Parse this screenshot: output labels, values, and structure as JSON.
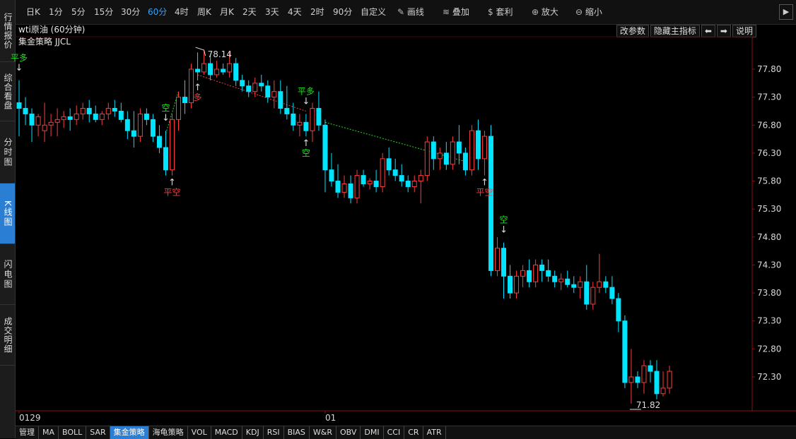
{
  "sidebar": {
    "tabs": [
      {
        "label": "行情报价",
        "active": false
      },
      {
        "label": "综合看盘",
        "active": false
      },
      {
        "label": "分时图",
        "active": false
      },
      {
        "label": "K线图",
        "active": true
      },
      {
        "label": "闪电图",
        "active": false
      },
      {
        "label": "成交明细",
        "active": false
      }
    ]
  },
  "toolbar": {
    "periods": [
      "日K",
      "1分",
      "5分",
      "15分",
      "30分",
      "60分",
      "4时",
      "周K",
      "月K",
      "2天",
      "3天",
      "4天",
      "2时",
      "90分",
      "自定义"
    ],
    "active_period": "60分",
    "tools": [
      {
        "label": "画线",
        "icon": "pencil-icon"
      },
      {
        "label": "叠加",
        "icon": "stack-icon"
      },
      {
        "label": "套利",
        "icon": "money-bag-icon"
      },
      {
        "label": "放大",
        "icon": "zoom-in-icon"
      },
      {
        "label": "缩小",
        "icon": "zoom-out-icon"
      }
    ],
    "expand_icon": "chevron-right-icon"
  },
  "chart_header": {
    "title": "wti原油 (60分钟)",
    "strategy": "集金策略 JJCL",
    "buttons": [
      "改参数",
      "隐藏主指标",
      "⬅",
      "➡",
      "说明"
    ]
  },
  "chart_data": {
    "type": "candlestick",
    "y_ticks": [
      77.8,
      77.3,
      76.8,
      76.3,
      75.8,
      75.3,
      74.8,
      74.3,
      73.8,
      73.3,
      72.8,
      72.3
    ],
    "ylim": [
      71.74,
      78.42
    ],
    "x_tick_labels": [
      {
        "label": "0129",
        "index": 0
      },
      {
        "label": "01",
        "index": 48
      }
    ],
    "colors": {
      "up": "#ff3c3c",
      "down": "#00e5ff",
      "axis": "#8a1010",
      "signal_buy": "#ff3c3c",
      "signal_sell": "#22dd22"
    },
    "high_label": "78.14",
    "low_label": "71.82",
    "candles": [
      [
        77.2,
        77.6,
        76.6,
        77.1
      ],
      [
        77.1,
        77.3,
        76.8,
        77.0
      ],
      [
        77.0,
        77.1,
        76.5,
        76.8
      ],
      [
        76.8,
        77.0,
        76.6,
        76.95
      ],
      [
        76.7,
        77.2,
        76.5,
        76.8
      ],
      [
        76.8,
        77.0,
        76.6,
        76.85
      ],
      [
        76.85,
        77.1,
        76.6,
        76.9
      ],
      [
        76.9,
        77.05,
        76.75,
        76.95
      ],
      [
        76.95,
        77.1,
        76.7,
        76.9
      ],
      [
        76.9,
        77.15,
        76.8,
        77.0
      ],
      [
        77.0,
        77.2,
        76.9,
        77.1
      ],
      [
        77.1,
        77.25,
        76.85,
        77.0
      ],
      [
        77.0,
        77.15,
        76.85,
        76.9
      ],
      [
        76.9,
        77.05,
        76.8,
        77.0
      ],
      [
        77.0,
        77.2,
        76.9,
        77.1
      ],
      [
        77.1,
        77.25,
        76.95,
        77.05
      ],
      [
        77.05,
        77.2,
        76.85,
        76.9
      ],
      [
        76.9,
        77.05,
        76.55,
        76.7
      ],
      [
        76.7,
        77.05,
        76.4,
        76.6
      ],
      [
        76.6,
        77.1,
        76.5,
        77.0
      ],
      [
        77.0,
        77.1,
        76.8,
        76.9
      ],
      [
        76.9,
        77.0,
        76.5,
        76.6
      ],
      [
        76.6,
        76.8,
        76.3,
        76.4
      ],
      [
        76.4,
        76.7,
        75.9,
        76.0
      ],
      [
        76.0,
        77.0,
        75.9,
        76.9
      ],
      [
        76.9,
        77.4,
        76.7,
        77.3
      ],
      [
        77.3,
        77.6,
        77.0,
        77.2
      ],
      [
        77.2,
        77.9,
        77.1,
        77.8
      ],
      [
        77.8,
        78.1,
        77.6,
        77.75
      ],
      [
        77.75,
        78.14,
        77.7,
        77.9
      ],
      [
        77.9,
        78.05,
        77.6,
        77.7
      ],
      [
        77.7,
        77.95,
        77.65,
        77.8
      ],
      [
        77.8,
        77.9,
        77.7,
        77.75
      ],
      [
        77.75,
        78.1,
        77.65,
        77.9
      ],
      [
        77.9,
        78.0,
        77.5,
        77.6
      ],
      [
        77.6,
        77.7,
        77.4,
        77.5
      ],
      [
        77.5,
        77.6,
        77.3,
        77.4
      ],
      [
        77.4,
        77.65,
        77.3,
        77.55
      ],
      [
        77.55,
        77.7,
        77.4,
        77.5
      ],
      [
        77.5,
        77.6,
        77.2,
        77.3
      ],
      [
        77.3,
        77.6,
        77.1,
        77.4
      ],
      [
        77.4,
        77.6,
        77.0,
        77.1
      ],
      [
        77.1,
        77.5,
        76.9,
        77.0
      ],
      [
        77.0,
        77.2,
        76.7,
        76.8
      ],
      [
        76.8,
        77.0,
        76.6,
        76.85
      ],
      [
        76.85,
        77.0,
        76.6,
        76.7
      ],
      [
        76.7,
        77.2,
        76.5,
        77.1
      ],
      [
        77.1,
        77.4,
        76.7,
        76.8
      ],
      [
        76.8,
        76.9,
        75.6,
        76.0
      ],
      [
        76.0,
        76.3,
        75.7,
        75.8
      ],
      [
        75.8,
        76.1,
        75.5,
        75.6
      ],
      [
        75.6,
        75.9,
        75.5,
        75.75
      ],
      [
        75.75,
        75.9,
        75.4,
        75.5
      ],
      [
        75.5,
        76.0,
        75.4,
        75.9
      ],
      [
        75.9,
        76.0,
        75.7,
        75.75
      ],
      [
        75.75,
        75.85,
        75.65,
        75.8
      ],
      [
        75.8,
        76.0,
        75.6,
        75.7
      ],
      [
        75.7,
        76.3,
        75.6,
        76.2
      ],
      [
        76.2,
        76.4,
        75.9,
        76.0
      ],
      [
        76.0,
        76.2,
        75.8,
        75.9
      ],
      [
        75.9,
        76.1,
        75.7,
        75.8
      ],
      [
        75.8,
        75.9,
        75.6,
        75.7
      ],
      [
        75.7,
        75.9,
        75.6,
        75.8
      ],
      [
        75.8,
        76.0,
        75.4,
        75.9
      ],
      [
        75.9,
        76.6,
        75.8,
        76.5
      ],
      [
        76.5,
        76.6,
        76.0,
        76.2
      ],
      [
        76.2,
        76.4,
        76.0,
        76.3
      ],
      [
        76.3,
        76.5,
        76.0,
        76.1
      ],
      [
        76.1,
        76.6,
        76.0,
        76.5
      ],
      [
        76.5,
        76.8,
        76.1,
        76.3
      ],
      [
        76.3,
        76.4,
        75.9,
        76.0
      ],
      [
        76.0,
        76.8,
        75.9,
        76.7
      ],
      [
        76.7,
        76.9,
        76.0,
        76.2
      ],
      [
        76.2,
        76.7,
        75.9,
        76.6
      ],
      [
        76.6,
        76.8,
        74.1,
        74.2
      ],
      [
        74.2,
        74.8,
        74.1,
        74.6
      ],
      [
        74.6,
        74.7,
        73.7,
        74.1
      ],
      [
        74.1,
        74.3,
        73.7,
        73.8
      ],
      [
        73.8,
        74.2,
        73.7,
        74.1
      ],
      [
        74.1,
        74.3,
        73.9,
        74.2
      ],
      [
        74.2,
        74.4,
        73.9,
        74.0
      ],
      [
        74.0,
        74.4,
        73.9,
        74.3
      ],
      [
        74.3,
        74.4,
        74.0,
        74.2
      ],
      [
        74.2,
        74.4,
        74.0,
        74.1
      ],
      [
        74.1,
        74.2,
        73.9,
        74.0
      ],
      [
        74.0,
        74.15,
        73.85,
        74.05
      ],
      [
        74.05,
        74.2,
        73.9,
        73.95
      ],
      [
        73.95,
        74.1,
        73.8,
        73.9
      ],
      [
        73.9,
        74.1,
        73.7,
        74.0
      ],
      [
        74.0,
        74.3,
        73.5,
        73.6
      ],
      [
        73.6,
        74.0,
        73.5,
        73.9
      ],
      [
        73.9,
        74.5,
        73.8,
        74.0
      ],
      [
        74.0,
        74.1,
        73.8,
        73.9
      ],
      [
        73.9,
        74.1,
        73.6,
        73.7
      ],
      [
        73.7,
        73.8,
        73.1,
        73.3
      ],
      [
        73.3,
        73.4,
        72.1,
        72.2
      ],
      [
        72.2,
        72.8,
        71.82,
        72.3
      ],
      [
        72.3,
        72.4,
        72.1,
        72.2
      ],
      [
        72.2,
        72.6,
        72.0,
        72.5
      ],
      [
        72.5,
        72.6,
        72.2,
        72.4
      ],
      [
        72.4,
        72.6,
        71.9,
        72.0
      ],
      [
        72.0,
        72.4,
        71.95,
        72.1
      ],
      [
        72.1,
        72.5,
        72.0,
        72.4
      ]
    ],
    "signals": [
      {
        "index": 0,
        "label": "平多",
        "kind": "sell",
        "pos": "above"
      },
      {
        "index": 23,
        "label": "空",
        "kind": "sell",
        "pos": "above"
      },
      {
        "index": 24,
        "label": "平空",
        "kind": "buy",
        "pos": "below"
      },
      {
        "index": 28,
        "label": "多",
        "kind": "buy",
        "pos": "below"
      },
      {
        "index": 45,
        "label": "平多",
        "kind": "sell",
        "pos": "above"
      },
      {
        "index": 45,
        "label": "空",
        "kind": "sell",
        "pos": "below"
      },
      {
        "index": 73,
        "label": "平空",
        "kind": "buy",
        "pos": "below"
      },
      {
        "index": 76,
        "label": "空",
        "kind": "sell",
        "pos": "above"
      }
    ],
    "trend_lines": [
      {
        "from": [
          23,
          76.65
        ],
        "to": [
          25,
          77.4
        ],
        "color": "#22dd22"
      },
      {
        "from": [
          28,
          77.7
        ],
        "to": [
          45,
          77.05
        ],
        "color": "#ff3c3c"
      },
      {
        "from": [
          48,
          76.85
        ],
        "to": [
          70,
          76.15
        ],
        "color": "#22dd22"
      }
    ]
  },
  "bottom_tabs": {
    "items": [
      "管理",
      "MA",
      "BOLL",
      "SAR",
      "集金策略",
      "海龟策略",
      "VOL",
      "MACD",
      "KDJ",
      "RSI",
      "BIAS",
      "W&R",
      "OBV",
      "DMI",
      "CCI",
      "CR",
      "ATR"
    ],
    "active": "集金策略"
  }
}
